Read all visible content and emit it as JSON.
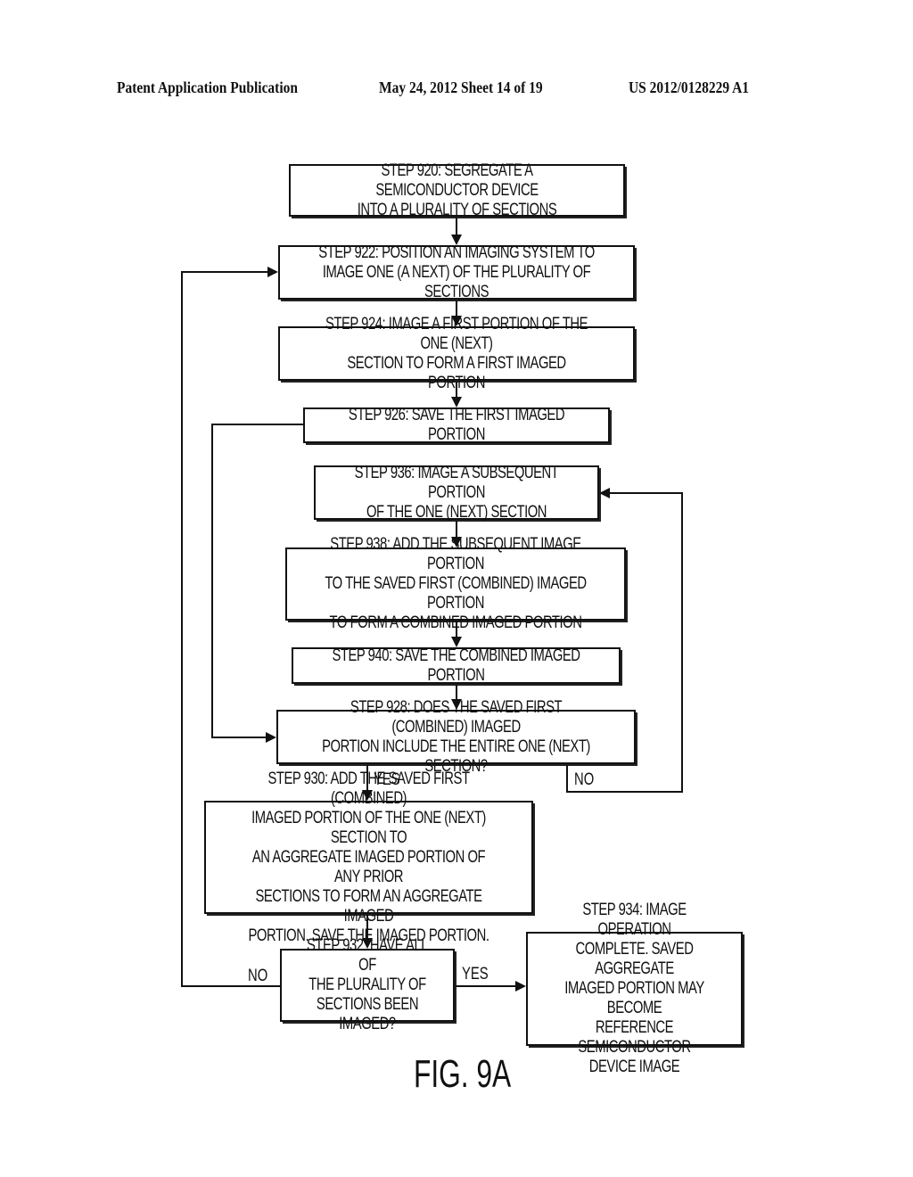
{
  "header": {
    "publication": "Patent Application Publication",
    "date_sheet": "May 24, 2012   Sheet 14 of 19",
    "number": "US 2012/0128229 A1"
  },
  "steps": {
    "s920": "STEP 920: SEGREGATE A SEMICONDUCTOR DEVICE\nINTO A PLURALITY OF SECTIONS",
    "s922": "STEP 922: POSITION AN IMAGING SYSTEM TO\nIMAGE ONE (A NEXT) OF THE PLURALITY OF SECTIONS",
    "s924": "STEP 924: IMAGE A FIRST PORTION OF THE ONE (NEXT)\nSECTION TO FORM A FIRST IMAGED PORTION",
    "s926": "STEP 926: SAVE THE FIRST IMAGED PORTION",
    "s936": "STEP 936: IMAGE A SUBSEQUENT PORTION\nOF THE ONE (NEXT) SECTION",
    "s938": "STEP 938: ADD THE SUBSEQUENT IMAGE PORTION\nTO THE SAVED FIRST (COMBINED) IMAGED PORTION\nTO FORM A COMBINED IMAGED PORTION",
    "s940": "STEP 940: SAVE THE COMBINED IMAGED PORTION",
    "s928": "STEP 928: DOES THE SAVED FIRST (COMBINED) IMAGED\nPORTION INCLUDE THE ENTIRE ONE (NEXT) SECTION?",
    "s930": "STEP 930: ADD THE SAVED FIRST (COMBINED)\nIMAGED PORTION OF THE ONE (NEXT) SECTION TO\nAN AGGREGATE IMAGED PORTION OF ANY PRIOR\nSECTIONS TO FORM AN AGGREGATE IMAGED\nPORTION. SAVE THE IMAGED PORTION.",
    "s932": "STEP 932: HAVE ALL OF\nTHE PLURALITY OF\nSECTIONS BEEN IMAGED?",
    "s934": "STEP 934: IMAGE OPERATION\nCOMPLETE.  SAVED AGGREGATE\nIMAGED PORTION MAY BECOME\nREFERENCE SEMICONDUCTOR\nDEVICE IMAGE"
  },
  "labels": {
    "yes_928": "YES",
    "no_928": "NO",
    "no_932": "NO",
    "yes_932": "YES"
  },
  "figure_label": "FIG. 9A"
}
